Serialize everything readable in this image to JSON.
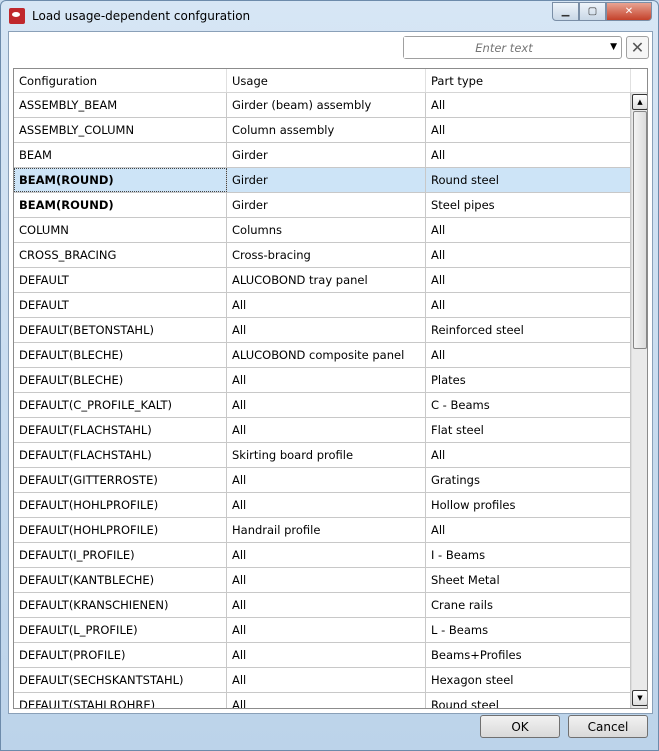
{
  "window": {
    "title": "Load usage-dependent confguration"
  },
  "search": {
    "placeholder": "Enter text"
  },
  "table": {
    "headers": [
      "Configuration",
      "Usage",
      "Part type"
    ],
    "selected_index": 3,
    "rows": [
      {
        "config": "ASSEMBLY_BEAM",
        "usage": "Girder (beam) assembly",
        "part": "All"
      },
      {
        "config": "ASSEMBLY_COLUMN",
        "usage": "Column assembly",
        "part": "All"
      },
      {
        "config": "BEAM",
        "usage": "Girder",
        "part": "All"
      },
      {
        "config": "BEAM(ROUND)",
        "usage": "Girder",
        "part": "Round steel",
        "bold": true
      },
      {
        "config": "BEAM(ROUND)",
        "usage": "Girder",
        "part": "Steel pipes",
        "bold": true
      },
      {
        "config": "COLUMN",
        "usage": "Columns",
        "part": "All"
      },
      {
        "config": "CROSS_BRACING",
        "usage": "Cross-bracing",
        "part": "All"
      },
      {
        "config": "DEFAULT",
        "usage": "ALUCOBOND tray panel",
        "part": "All"
      },
      {
        "config": "DEFAULT",
        "usage": "All",
        "part": "All"
      },
      {
        "config": "DEFAULT(BETONSTAHL)",
        "usage": "All",
        "part": "Reinforced steel"
      },
      {
        "config": "DEFAULT(BLECHE)",
        "usage": "ALUCOBOND composite panel",
        "part": "All"
      },
      {
        "config": "DEFAULT(BLECHE)",
        "usage": "All",
        "part": "Plates"
      },
      {
        "config": "DEFAULT(C_PROFILE_KALT)",
        "usage": "All",
        "part": "C - Beams"
      },
      {
        "config": "DEFAULT(FLACHSTAHL)",
        "usage": "All",
        "part": "Flat steel"
      },
      {
        "config": "DEFAULT(FLACHSTAHL)",
        "usage": "Skirting board profile",
        "part": "All"
      },
      {
        "config": "DEFAULT(GITTERROSTE)",
        "usage": "All",
        "part": "Gratings"
      },
      {
        "config": "DEFAULT(HOHLPROFILE)",
        "usage": "All",
        "part": "Hollow profiles"
      },
      {
        "config": "DEFAULT(HOHLPROFILE)",
        "usage": "Handrail profile",
        "part": "All"
      },
      {
        "config": "DEFAULT(I_PROFILE)",
        "usage": "All",
        "part": "I - Beams"
      },
      {
        "config": "DEFAULT(KANTBLECHE)",
        "usage": "All",
        "part": "Sheet Metal"
      },
      {
        "config": "DEFAULT(KRANSCHIENEN)",
        "usage": "All",
        "part": "Crane rails"
      },
      {
        "config": "DEFAULT(L_PROFILE)",
        "usage": "All",
        "part": "L - Beams"
      },
      {
        "config": "DEFAULT(PROFILE)",
        "usage": "All",
        "part": "Beams+Profiles"
      },
      {
        "config": "DEFAULT(SECHSKANTSTAHL)",
        "usage": "All",
        "part": "Hexagon steel"
      },
      {
        "config": "DEFAULT(STAHLROHRE)",
        "usage": "All",
        "part": "Round steel"
      }
    ]
  },
  "buttons": {
    "ok": "OK",
    "cancel": "Cancel"
  }
}
